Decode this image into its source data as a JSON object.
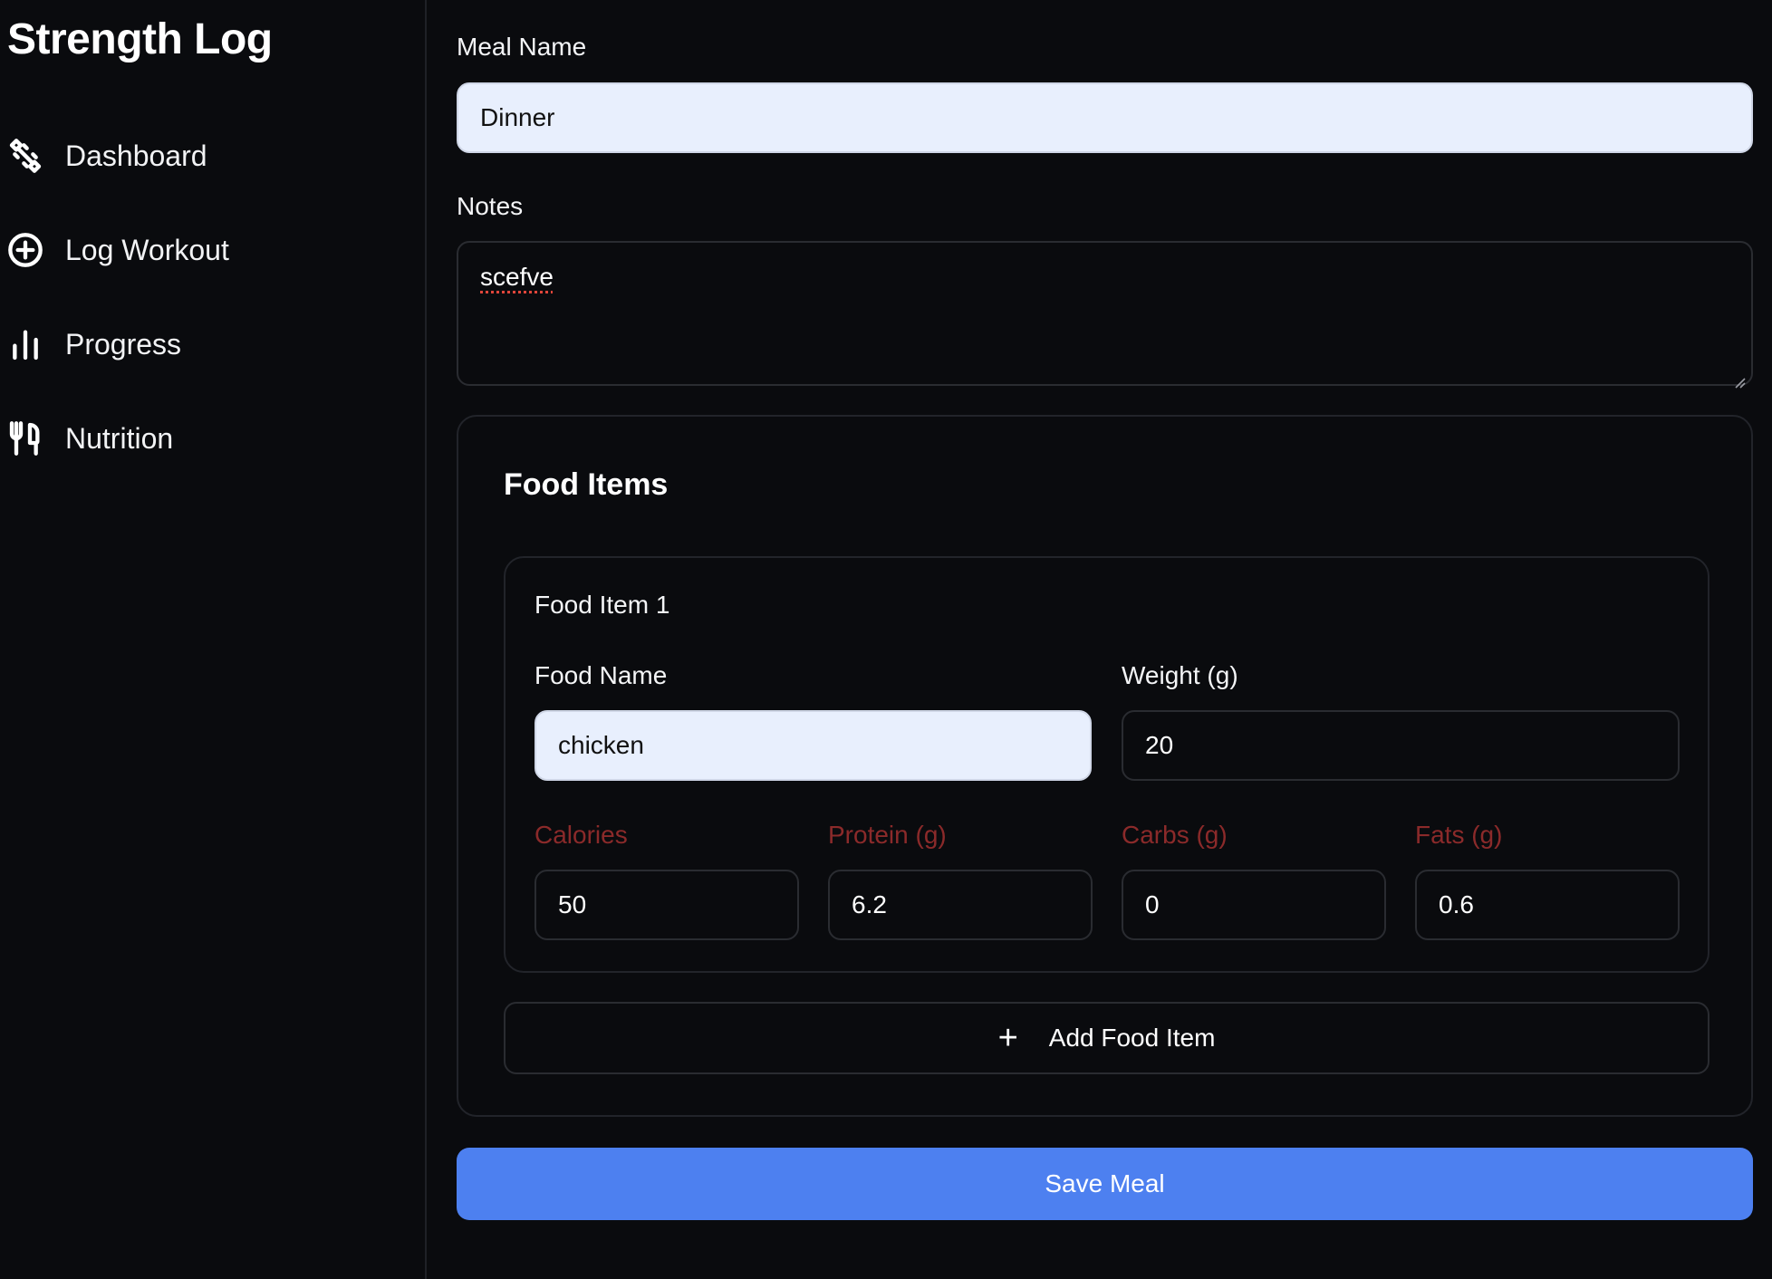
{
  "app": {
    "title": "Strength Log"
  },
  "sidebar": {
    "items": [
      {
        "label": "Dashboard",
        "icon": "dumbbell-icon"
      },
      {
        "label": "Log Workout",
        "icon": "plus-circle-icon"
      },
      {
        "label": "Progress",
        "icon": "bar-chart-icon"
      },
      {
        "label": "Nutrition",
        "icon": "utensils-icon"
      }
    ]
  },
  "form": {
    "meal_name_label": "Meal Name",
    "meal_name_value": "Dinner",
    "notes_label": "Notes",
    "notes_value": "scefve",
    "food_items_title": "Food Items",
    "food_item": {
      "title": "Food Item 1",
      "food_name_label": "Food Name",
      "food_name_value": "chicken",
      "weight_label": "Weight (g)",
      "weight_value": "20",
      "calories_label": "Calories",
      "calories_value": "50",
      "protein_label": "Protein (g)",
      "protein_value": "6.2",
      "carbs_label": "Carbs (g)",
      "carbs_value": "0",
      "fats_label": "Fats (g)",
      "fats_value": "0.6"
    },
    "add_food_item_label": "Add Food Item",
    "save_meal_label": "Save Meal"
  },
  "colors": {
    "background": "#0a0b0e",
    "accent": "#4d80f0",
    "macro_label": "#8b2a2a",
    "filled_input": "#e8effd"
  }
}
